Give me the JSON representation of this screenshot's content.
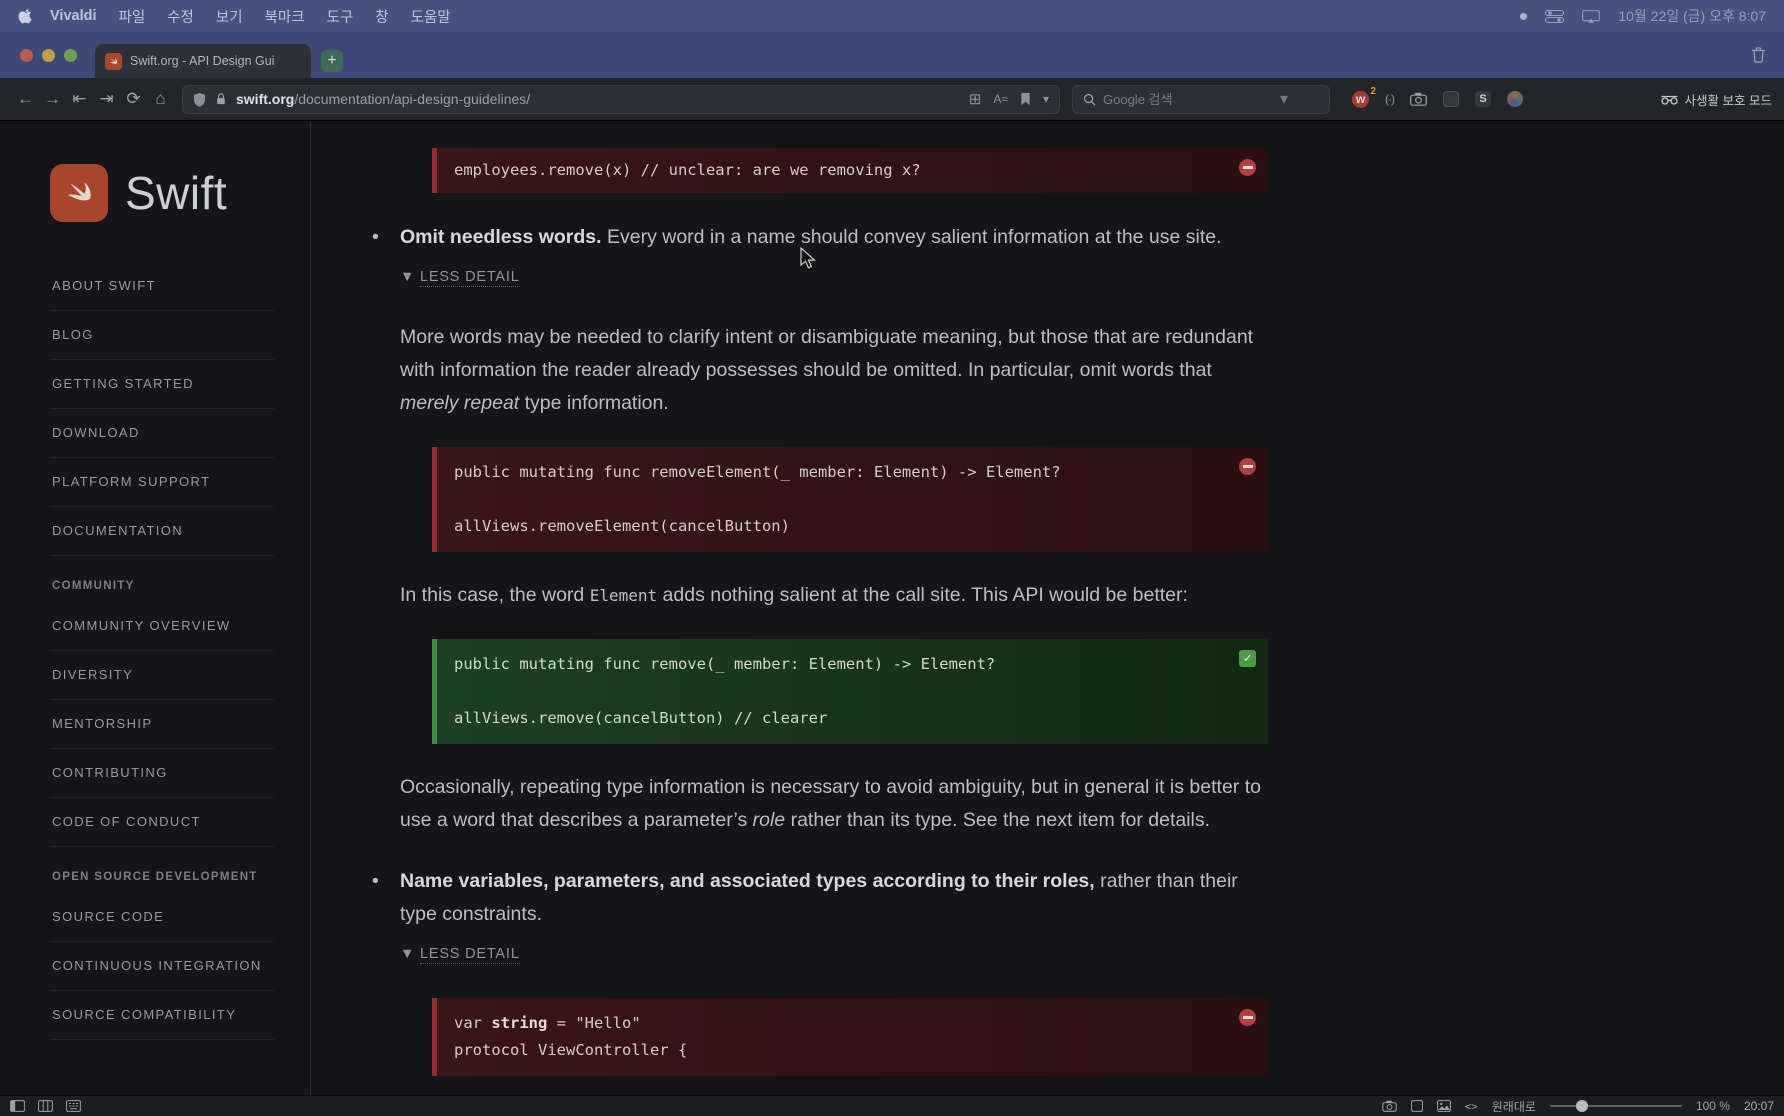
{
  "menubar": {
    "app_name": "Vivaldi",
    "items": [
      "파일",
      "수정",
      "보기",
      "북마크",
      "도구",
      "창",
      "도움말"
    ],
    "clock": "10월 22일 (금) 오후 8:07"
  },
  "tabbar": {
    "tab_title": "Swift.org - API Design Gui",
    "new_tab_label": "+"
  },
  "toolbar": {
    "url_host": "swift.org",
    "url_path": "/documentation/api-design-guidelines/",
    "search_placeholder": "Google 검색",
    "extension_w": "w",
    "extension_badge": "2",
    "shortcut_letter": "S",
    "private_mode_label": "사생활 보호 모드"
  },
  "icons": {
    "back": "←",
    "forward": "→",
    "rewind": "⇤",
    "fastforward": "⇥",
    "reload": "⟳",
    "home": "⌂",
    "chevron_down": "▾",
    "reader": "A≈",
    "paren": "(·)",
    "grid": "⊞"
  },
  "sidebar": {
    "logo_text": "Swift",
    "primary": [
      "ABOUT SWIFT",
      "BLOG",
      "GETTING STARTED",
      "DOWNLOAD",
      "PLATFORM SUPPORT",
      "DOCUMENTATION"
    ],
    "community_header": "COMMUNITY",
    "community": [
      "COMMUNITY OVERVIEW",
      "DIVERSITY",
      "MENTORSHIP",
      "CONTRIBUTING",
      "CODE OF CONDUCT"
    ],
    "osd_header": "OPEN SOURCE DEVELOPMENT",
    "osd": [
      "SOURCE CODE",
      "CONTINUOUS INTEGRATION",
      "SOURCE COMPATIBILITY"
    ]
  },
  "content": {
    "code_top_line1": "employees.remove(x) // unclear: are we removing x?",
    "bullet1_bold": "Omit needless words.",
    "bullet1_rest": " Every word in a name should convey salient information at the use site.",
    "less_detail_glyph": "▼",
    "less_detail_label": "LESS DETAIL",
    "para1_pre": "More words may be needed to clarify intent or disambiguate meaning, but those that are redundant with information the reader already possesses should be omitted. In particular, omit words that ",
    "para1_italic": "merely repeat",
    "para1_post": " type information.",
    "code_bad_line1": "public mutating func removeElement(_ member: Element) -> Element?",
    "code_bad_line2": "allViews.removeElement(cancelButton)",
    "para2_pre": "In this case, the word ",
    "para2_code": "Element",
    "para2_post": " adds nothing salient at the call site. This API would be better:",
    "code_good_line1": "public mutating func remove(_ member: Element) -> Element?",
    "code_good_line2": "allViews.remove(cancelButton) // clearer",
    "para3_pre": "Occasionally, repeating type information is necessary to avoid ambiguity, but in general it is better to use a word that describes a parameter’s ",
    "para3_italic": "role",
    "para3_post": " rather than its type. See the next item for details.",
    "bullet2_bold": "Name variables, parameters, and associated types according to their roles,",
    "bullet2_rest": " rather than their type constraints.",
    "code_bottom_line1_pre": "var ",
    "code_bottom_line1_bold": "string",
    "code_bottom_line1_post": " = \"Hello\"",
    "code_bottom_line2": "protocol ViewController {"
  },
  "statusbar": {
    "code_glyph": "<>",
    "reset_zoom_label": "원래대로",
    "zoom_level": "100 %",
    "time": "20:07"
  }
}
